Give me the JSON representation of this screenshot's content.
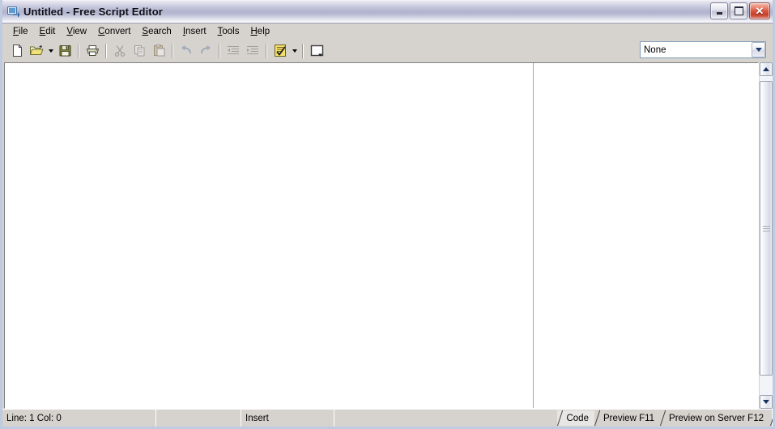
{
  "window": {
    "title": "Untitled - Free Script Editor",
    "icon": "script-editor-app-icon",
    "buttons": {
      "minimize": "minimize-button",
      "maximize": "maximize-button",
      "close": "close-button",
      "close_glyph": "✕"
    }
  },
  "menubar": {
    "items": [
      {
        "label": "File",
        "accel": "F"
      },
      {
        "label": "Edit",
        "accel": "E"
      },
      {
        "label": "View",
        "accel": "V"
      },
      {
        "label": "Convert",
        "accel": "C"
      },
      {
        "label": "Search",
        "accel": "S"
      },
      {
        "label": "Insert",
        "accel": "I"
      },
      {
        "label": "Tools",
        "accel": "T"
      },
      {
        "label": "Help",
        "accel": "H"
      }
    ]
  },
  "toolbar": {
    "buttons": [
      {
        "name": "new-file-button",
        "icon": "new-page-icon",
        "enabled": true,
        "tooltip": "New"
      },
      {
        "name": "open-file-button",
        "icon": "open-folder-icon",
        "enabled": true,
        "tooltip": "Open"
      },
      {
        "name": "save-file-button",
        "icon": "floppy-save-icon",
        "enabled": true,
        "tooltip": "Save"
      },
      {
        "name": "print-button",
        "icon": "printer-icon",
        "enabled": true,
        "tooltip": "Print"
      },
      {
        "name": "cut-button",
        "icon": "scissors-icon",
        "enabled": false,
        "tooltip": "Cut"
      },
      {
        "name": "copy-button",
        "icon": "copy-pages-icon",
        "enabled": false,
        "tooltip": "Copy"
      },
      {
        "name": "paste-button",
        "icon": "clipboard-icon",
        "enabled": false,
        "tooltip": "Paste"
      },
      {
        "name": "undo-button",
        "icon": "undo-arrow-icon",
        "enabled": false,
        "tooltip": "Undo"
      },
      {
        "name": "redo-button",
        "icon": "redo-arrow-icon",
        "enabled": false,
        "tooltip": "Redo"
      },
      {
        "name": "outdent-button",
        "icon": "outdent-icon",
        "enabled": false,
        "tooltip": "Decrease Indent"
      },
      {
        "name": "indent-button",
        "icon": "indent-icon",
        "enabled": false,
        "tooltip": "Increase Indent"
      },
      {
        "name": "validate-button",
        "icon": "checklist-icon",
        "enabled": true,
        "tooltip": "Validate"
      },
      {
        "name": "frame-button",
        "icon": "frame-icon",
        "enabled": true,
        "tooltip": "Frame"
      }
    ],
    "style_combo": {
      "value": "None",
      "placeholder": "None"
    }
  },
  "editor": {
    "content": "",
    "right_pane_content": ""
  },
  "statusbar": {
    "line_label": "Line:",
    "line_value": "1",
    "col_label": "Col:",
    "col_value": "0",
    "position_text": "Line:  1  Col:  0",
    "panel2": "",
    "mode": "Insert",
    "panel4": ""
  },
  "tabs": [
    {
      "label": "Code",
      "active": true
    },
    {
      "label": "Preview F11",
      "active": false
    },
    {
      "label": "Preview on Server F12",
      "active": false
    }
  ],
  "colors": {
    "window_face": "#d6d3ce",
    "editor_bg": "#ffffff",
    "title_text": "#0d0d18",
    "close_button": "#d4503a",
    "accent": "#b1b4cd"
  }
}
